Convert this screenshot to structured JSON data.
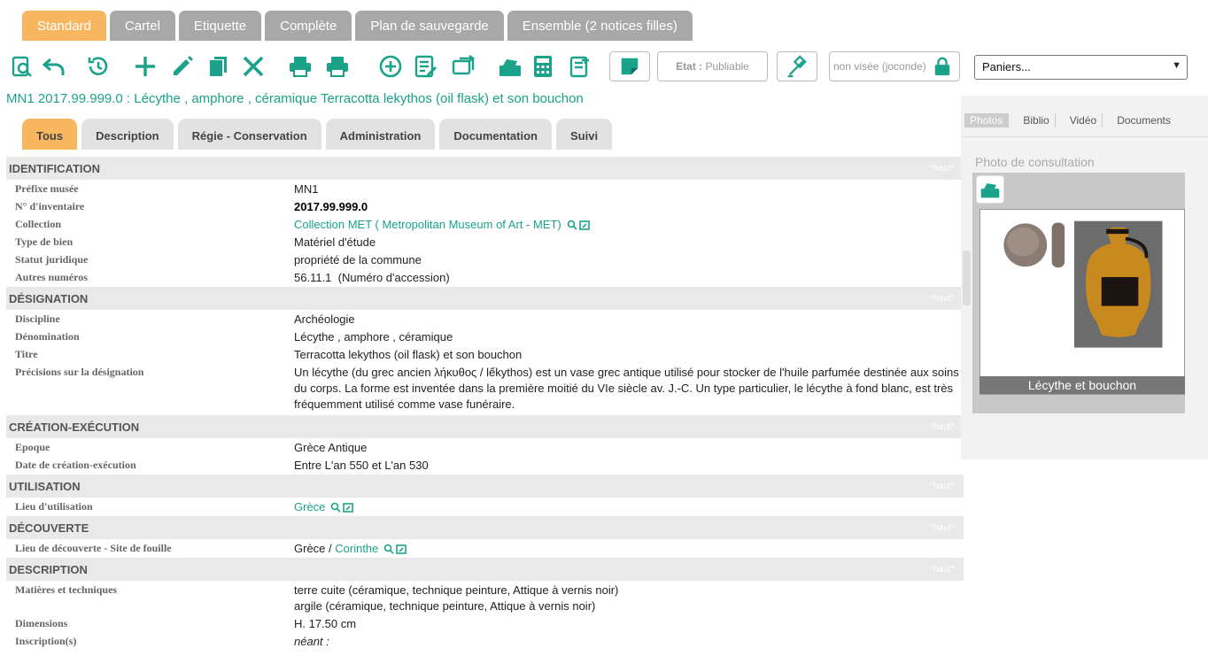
{
  "top_tabs": [
    "Standard",
    "Cartel",
    "Etiquette",
    "Complète",
    "Plan de sauvegarde",
    "Ensemble (2 notices filles)"
  ],
  "toolbar": {
    "etat_label": "Etat :",
    "etat_value": "Publiable",
    "visee_text": "non visée (joconde)",
    "paniers_value": "Paniers..."
  },
  "record": {
    "id": "MN1 2017.99.999.0",
    "sep": " : ",
    "title": "Lécythe , amphore , céramique Terracotta lekythos (oil flask) et son bouchon"
  },
  "sub_tabs": [
    "Tous",
    "Description",
    "Régie - Conservation",
    "Administration",
    "Documentation",
    "Suivi"
  ],
  "haut_label": "^haut^",
  "sections": {
    "identification": {
      "title": "IDENTIFICATION",
      "rows": [
        {
          "label": "Préfixe musée",
          "value": "MN1"
        },
        {
          "label": "N° d'inventaire",
          "value": "2017.99.999.0"
        },
        {
          "label": "Collection",
          "value": "Collection MET ( Metropolitan Museum of Art - MET)"
        },
        {
          "label": "Type de bien",
          "value": "Matériel d'étude"
        },
        {
          "label": "Statut juridique",
          "value": "propriété de la commune"
        },
        {
          "label": "Autres numéros",
          "value": "56.11.1  (Numéro d'accession)"
        }
      ]
    },
    "designation": {
      "title": "DÉSIGNATION",
      "rows": [
        {
          "label": "Discipline",
          "value": "Archéologie"
        },
        {
          "label": "Dénomination",
          "value": "Lécythe , amphore , céramique"
        },
        {
          "label": "Titre",
          "value": "Terracotta lekythos (oil flask) et son bouchon"
        },
        {
          "label": "Précisions sur la désignation",
          "value": "Un lécythe (du grec ancien λήκυθος / lếkythos) est un vase grec antique utilisé pour stocker de l'huile parfumée destinée aux soins du corps. La forme est inventée dans la première moitié du VIe siècle av. J.-C. Un type particulier, le lécythe à fond blanc, est très fréquemment utilisé comme vase funéraire."
        }
      ]
    },
    "creation": {
      "title": "CRÉATION-EXÉCUTION",
      "rows": [
        {
          "label": "Epoque",
          "value": "Grèce Antique"
        },
        {
          "label": "Date de création-exécution",
          "value": "Entre L'an 550 et L'an 530"
        }
      ]
    },
    "utilisation": {
      "title": "UTILISATION",
      "rows": [
        {
          "label": "Lieu d'utilisation",
          "value": "Grèce"
        }
      ]
    },
    "decouverte": {
      "title": "DÉCOUVERTE",
      "rows": [
        {
          "label": "Lieu de découverte - Site de fouille",
          "value_prefix": "Grèce / ",
          "value_link": "Corinthe"
        }
      ]
    },
    "description": {
      "title": "DESCRIPTION",
      "rows": [
        {
          "label": "Matières et techniques",
          "value1": "terre cuite (céramique, technique peinture, Attique à vernis noir)",
          "value2": "argile (céramique, technique peinture, Attique à vernis noir)"
        },
        {
          "label": "Dimensions",
          "value": "H. 17.50 cm"
        },
        {
          "label": "Inscription(s)",
          "value": "néant :"
        }
      ]
    }
  },
  "right_panel": {
    "tabs": [
      "Photos",
      "Biblio",
      "Vidéo",
      "Documents"
    ],
    "photo_label": "Photo de consultation",
    "caption": "Lécythe et bouchon"
  },
  "colors": {
    "accent": "#1aa38a",
    "tab_active": "#f9b661",
    "tab_inactive": "#a8a8a8"
  }
}
